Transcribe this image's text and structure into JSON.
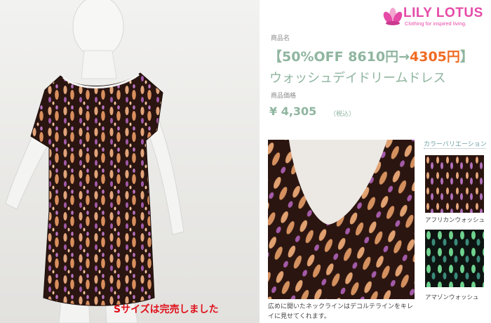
{
  "brand": {
    "name": "LILY LOTUS",
    "tagline": "Clothing for inspired living.",
    "color": "#e64aa7"
  },
  "product": {
    "name_label": "商品名",
    "sale_open": "【50%OFF ",
    "original_price": "8610円",
    "arrow": "→",
    "sale_price": "4305円",
    "sale_close": "】",
    "name": "ウォッシュデイドリームドレス",
    "price_label": "商品価格",
    "price": "¥ 4,305",
    "tax_note": "（税込）"
  },
  "main_photo": {
    "soldout_note": "Sサイズは完売しました"
  },
  "detail_photo": {
    "caption": "広めに開いたネックラインはデコルテラインをキレイに見せてくれます。"
  },
  "variations": {
    "title": "カラーバリエーション",
    "items": [
      {
        "label": "アフリカンウォッシュ",
        "icon": "african-wash-swatch"
      },
      {
        "label": "アマゾンウォッシュ",
        "icon": "amazon-wash-swatch"
      }
    ]
  },
  "colors": {
    "accent_green": "#8fb59f",
    "sale_orange": "#f06b23",
    "soldout_red": "#e0101a"
  }
}
